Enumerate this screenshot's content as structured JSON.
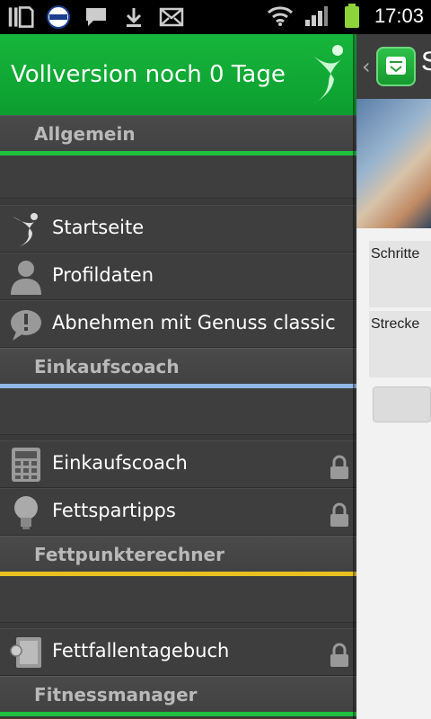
{
  "statusbar": {
    "time": "17:03",
    "icons": [
      "sim-card-icon",
      "soccer-club-icon",
      "chat-bubble-icon",
      "download-icon",
      "mail-icon",
      "wifi-icon",
      "signal-icon",
      "battery-icon"
    ]
  },
  "drawer": {
    "header_title": "Vollversion noch 0 Tage",
    "sections": [
      {
        "label": "Allgemein",
        "accent": "#1fc13f",
        "items": [
          {
            "label": "Startseite",
            "icon": "runner-icon",
            "locked": false
          },
          {
            "label": "Profildaten",
            "icon": "person-icon",
            "locked": false
          },
          {
            "label": "Abnehmen mit Genuss classic",
            "icon": "speech-exclamation-icon",
            "locked": false
          }
        ]
      },
      {
        "label": "Einkaufscoach",
        "accent": "#8fb8e6",
        "items": [
          {
            "label": "Einkaufscoach",
            "icon": "calculator-icon",
            "locked": true
          },
          {
            "label": "Fettspartipps",
            "icon": "lightbulb-icon",
            "locked": true
          }
        ]
      },
      {
        "label": "Fettpunkterechner",
        "accent": "#e8c020",
        "items": [
          {
            "label": "Fettfallentagebuch",
            "icon": "notebook-icon",
            "locked": true
          }
        ]
      },
      {
        "label": "Fitnessmanager",
        "accent": "#1fc13f",
        "items": []
      }
    ]
  },
  "background_app": {
    "title_partial": "S",
    "field1_label": "Schritte",
    "field2_label": "Strecke"
  },
  "colors": {
    "header_green": "#13ad36",
    "drawer_bg": "#3a3a3a"
  }
}
